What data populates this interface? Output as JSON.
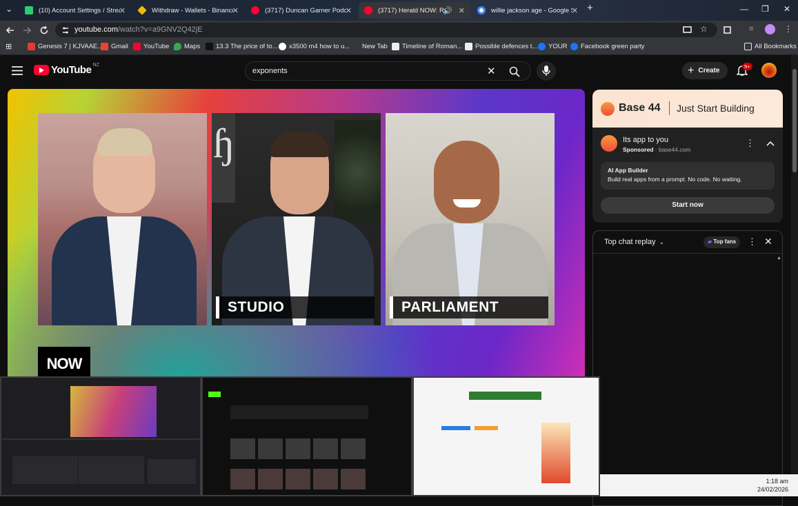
{
  "browser": {
    "tabs": [
      {
        "title": "(10) Account Settings / Streaml",
        "favicon_color": "#2ecc71"
      },
      {
        "title": "Withdraw - Wallets - Binance",
        "favicon_color": "#f0b90b"
      },
      {
        "title": "(3717) Duncan Garner Podcast",
        "favicon_color": "#ff0033"
      },
      {
        "title": "(3717) Herald NOW: Ryan B",
        "favicon_color": "#ff0033"
      },
      {
        "title": "willie jackson age - Google Sea",
        "favicon_color": "#ffffff"
      }
    ],
    "url_host": "youtube.com",
    "url_path": "/watch?v=a9GNV2Q42jE",
    "bookmarks": [
      {
        "label": "Genesis 7 | KJVAAE...",
        "color": "#e53935"
      },
      {
        "label": "Gmail",
        "color": "#ea4335"
      },
      {
        "label": "YouTube",
        "color": "#ff0033"
      },
      {
        "label": "Maps",
        "color": "#34a853"
      },
      {
        "label": "13.3 The price of to...",
        "color": "#111111"
      },
      {
        "label": "x3500 m4 how to u...",
        "color": "#ffffff"
      },
      {
        "label": "New Tab",
        "color": "#8ab4f8"
      },
      {
        "label": "Timeline of Roman...",
        "color": "#eeeeee"
      },
      {
        "label": "Possible defences t...",
        "color": "#eeeeee"
      },
      {
        "label": "YOUR",
        "color": "#1877f2"
      },
      {
        "label": "Facebook green party",
        "color": "#1877f2"
      }
    ],
    "all_bookmarks": "All Bookmarks"
  },
  "youtube": {
    "logo_text": "YouTube",
    "region": "NZ",
    "search_query": "exponents",
    "create_label": "Create",
    "notification_count": "9+"
  },
  "video": {
    "panel_labels": [
      "STUDIO",
      "PARLIAMENT"
    ],
    "watermark": "NOW"
  },
  "ad": {
    "brand": "Base 44",
    "tagline": "Just Start Building",
    "title": "Its app to you",
    "sponsored": "Sponsored",
    "domain": "base44.com",
    "inner_title": "AI App Builder",
    "inner_body": "Build real apps from a prompt. No code. No waiting.",
    "cta": "Start now"
  },
  "chat": {
    "title": "Top chat replay",
    "top_fans": "Top fans"
  },
  "system": {
    "time": "1:18 am",
    "date": "24/02/2026"
  }
}
